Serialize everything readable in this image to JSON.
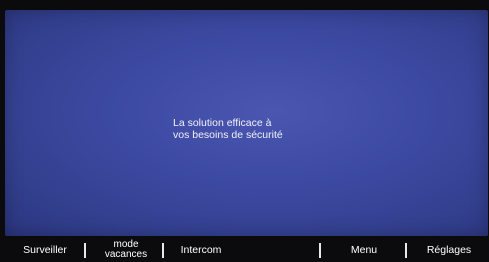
{
  "screen": {
    "message_line1": "La solution efficace à",
    "message_line2": "vos besoins de sécurité",
    "background_color": "#3d4aa3"
  },
  "softkeys": {
    "surveiller": "Surveiller",
    "mode_vacances_line1": "mode",
    "mode_vacances_line2": "vacances",
    "intercom": "Intercom",
    "menu": "Menu",
    "reglages": "Réglages",
    "separator": "|"
  }
}
